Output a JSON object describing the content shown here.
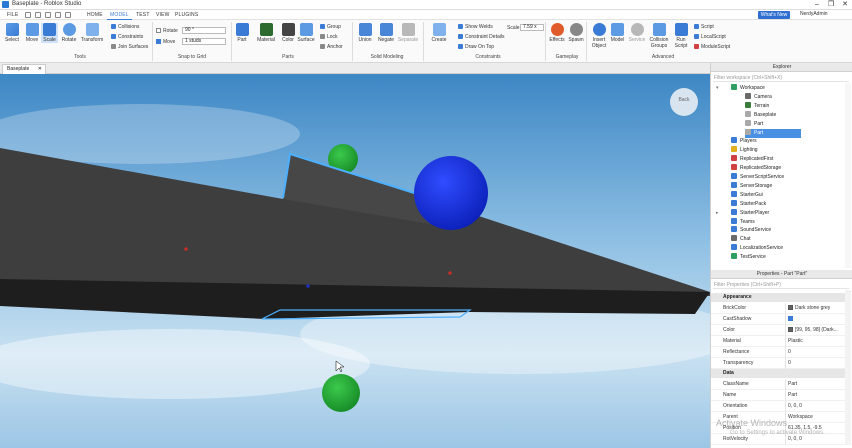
{
  "window": {
    "title": "Baseplate - Roblox Studio",
    "minimize": "–",
    "maximize": "❐",
    "close": "✕"
  },
  "menu": {
    "items": [
      "FILE",
      "HOME",
      "MODEL",
      "TEST",
      "VIEW",
      "PLUGINS"
    ],
    "active": "MODEL",
    "whats_new": "What's New",
    "user": "NerdyAdmin"
  },
  "ribbon": {
    "tools": {
      "select": "Select",
      "move": "Move",
      "scale": "Scale",
      "rotate": "Rotate",
      "transform": "Transform",
      "collisions": "Collisions",
      "constraints": "Constraints",
      "join_surfaces": "Join Surfaces",
      "group_label": "Tools"
    },
    "snap": {
      "rotate_label": "Rotate",
      "rotate_value": "90 °",
      "move_label": "Move",
      "move_value": "1 studs",
      "group_label": "Snap to Grid"
    },
    "parts": {
      "part": "Part",
      "material": "Material",
      "color": "Color",
      "surface": "Surface",
      "group": "Group",
      "lock": "Lock",
      "anchor": "Anchor",
      "group_label": "Parts"
    },
    "solid": {
      "union": "Union",
      "negate": "Negate",
      "separate": "Separate",
      "group_label": "Solid Modeling"
    },
    "constraints": {
      "create": "Create",
      "show_welds": "Show Welds",
      "constraint_details": "Constraint Details",
      "draw_on_top": "Draw On Top",
      "scale_label": "Scale",
      "scale_value": "7.59 x",
      "group_label": "Constraints"
    },
    "gameplay": {
      "effects": "Effects",
      "spawn": "Spawn",
      "group_label": "Gameplay"
    },
    "advanced": {
      "insert_object": "Insert Object",
      "model": "Model",
      "service": "Service",
      "collision_groups": "Collision Groups",
      "run_script": "Run Script",
      "script": "Script",
      "local_script": "LocalScript",
      "module_script": "ModuleScript",
      "group_label": "Advanced"
    }
  },
  "tabs": [
    {
      "label": "Baseplate",
      "close": "✕"
    }
  ],
  "viewport": {
    "compass": "Back"
  },
  "explorer": {
    "title": "Explorer",
    "filter_placeholder": "Filter workspace (Ctrl+Shift+X)",
    "items": [
      {
        "label": "Workspace",
        "icon": "workspace-icon",
        "color": "#2f9e62"
      },
      {
        "label": "Camera",
        "icon": "camera-icon",
        "color": "#6a6a6a"
      },
      {
        "label": "Terrain",
        "icon": "terrain-icon",
        "color": "#3a7d3a"
      },
      {
        "label": "Baseplate",
        "icon": "part-icon",
        "color": "#a9a9a9"
      },
      {
        "label": "Part",
        "icon": "part-icon",
        "color": "#a9a9a9"
      },
      {
        "label": "Part",
        "icon": "part-icon",
        "color": "#a9a9a9"
      },
      {
        "label": "Players",
        "icon": "players-icon",
        "color": "#3a7bd5"
      },
      {
        "label": "Lighting",
        "icon": "lighting-icon",
        "color": "#e0b020"
      },
      {
        "label": "ReplicatedFirst",
        "icon": "replicated-icon",
        "color": "#d04040"
      },
      {
        "label": "ReplicatedStorage",
        "icon": "replicated-icon",
        "color": "#d04040"
      },
      {
        "label": "ServerScriptService",
        "icon": "server-icon",
        "color": "#3a7bd5"
      },
      {
        "label": "ServerStorage",
        "icon": "server-icon",
        "color": "#3a7bd5"
      },
      {
        "label": "StarterGui",
        "icon": "gui-icon",
        "color": "#3a7bd5"
      },
      {
        "label": "StarterPack",
        "icon": "pack-icon",
        "color": "#3a7bd5"
      },
      {
        "label": "StarterPlayer",
        "icon": "player-icon",
        "color": "#3a7bd5"
      },
      {
        "label": "Teams",
        "icon": "teams-icon",
        "color": "#3a7bd5"
      },
      {
        "label": "SoundService",
        "icon": "sound-icon",
        "color": "#3a7bd5"
      },
      {
        "label": "Chat",
        "icon": "chat-icon",
        "color": "#6a6a6a"
      },
      {
        "label": "LocalizationService",
        "icon": "localization-icon",
        "color": "#3a7bd5"
      },
      {
        "label": "TestService",
        "icon": "test-icon",
        "color": "#2f9e62"
      }
    ]
  },
  "properties": {
    "title": "Properties - Part \"Part\"",
    "filter_placeholder": "Filter Properties (Ctrl+Shift+P)",
    "sections": [
      {
        "name": "Appearance",
        "rows": [
          {
            "name": "BrickColor",
            "value": "Dark stone grey",
            "swatch": "#636363"
          },
          {
            "name": "CastShadow",
            "value": "",
            "checkbox": true
          },
          {
            "name": "Color",
            "value": "[99, 95, 98] (Dark...",
            "swatch": "#635f62"
          },
          {
            "name": "Material",
            "value": "Plastic"
          },
          {
            "name": "Reflectance",
            "value": "0"
          },
          {
            "name": "Transparency",
            "value": "0"
          }
        ]
      },
      {
        "name": "Data",
        "rows": [
          {
            "name": "ClassName",
            "value": "Part"
          },
          {
            "name": "Name",
            "value": "Part"
          },
          {
            "name": "Orientation",
            "value": "0, 0, 0"
          },
          {
            "name": "Parent",
            "value": "Workspace"
          },
          {
            "name": "Position",
            "value": "61.35, 1.5, -9.5"
          },
          {
            "name": "RotVelocity",
            "value": "0, 0, 0"
          }
        ]
      }
    ]
  },
  "watermark": {
    "line1": "Activate Windows",
    "line2": "Go to Settings to activate Windows."
  },
  "colors": {
    "accent": "#3a7bd5",
    "selection": "#4a90e2",
    "sky_top": "#3e88c6",
    "part_dark": "#3f3f40"
  }
}
